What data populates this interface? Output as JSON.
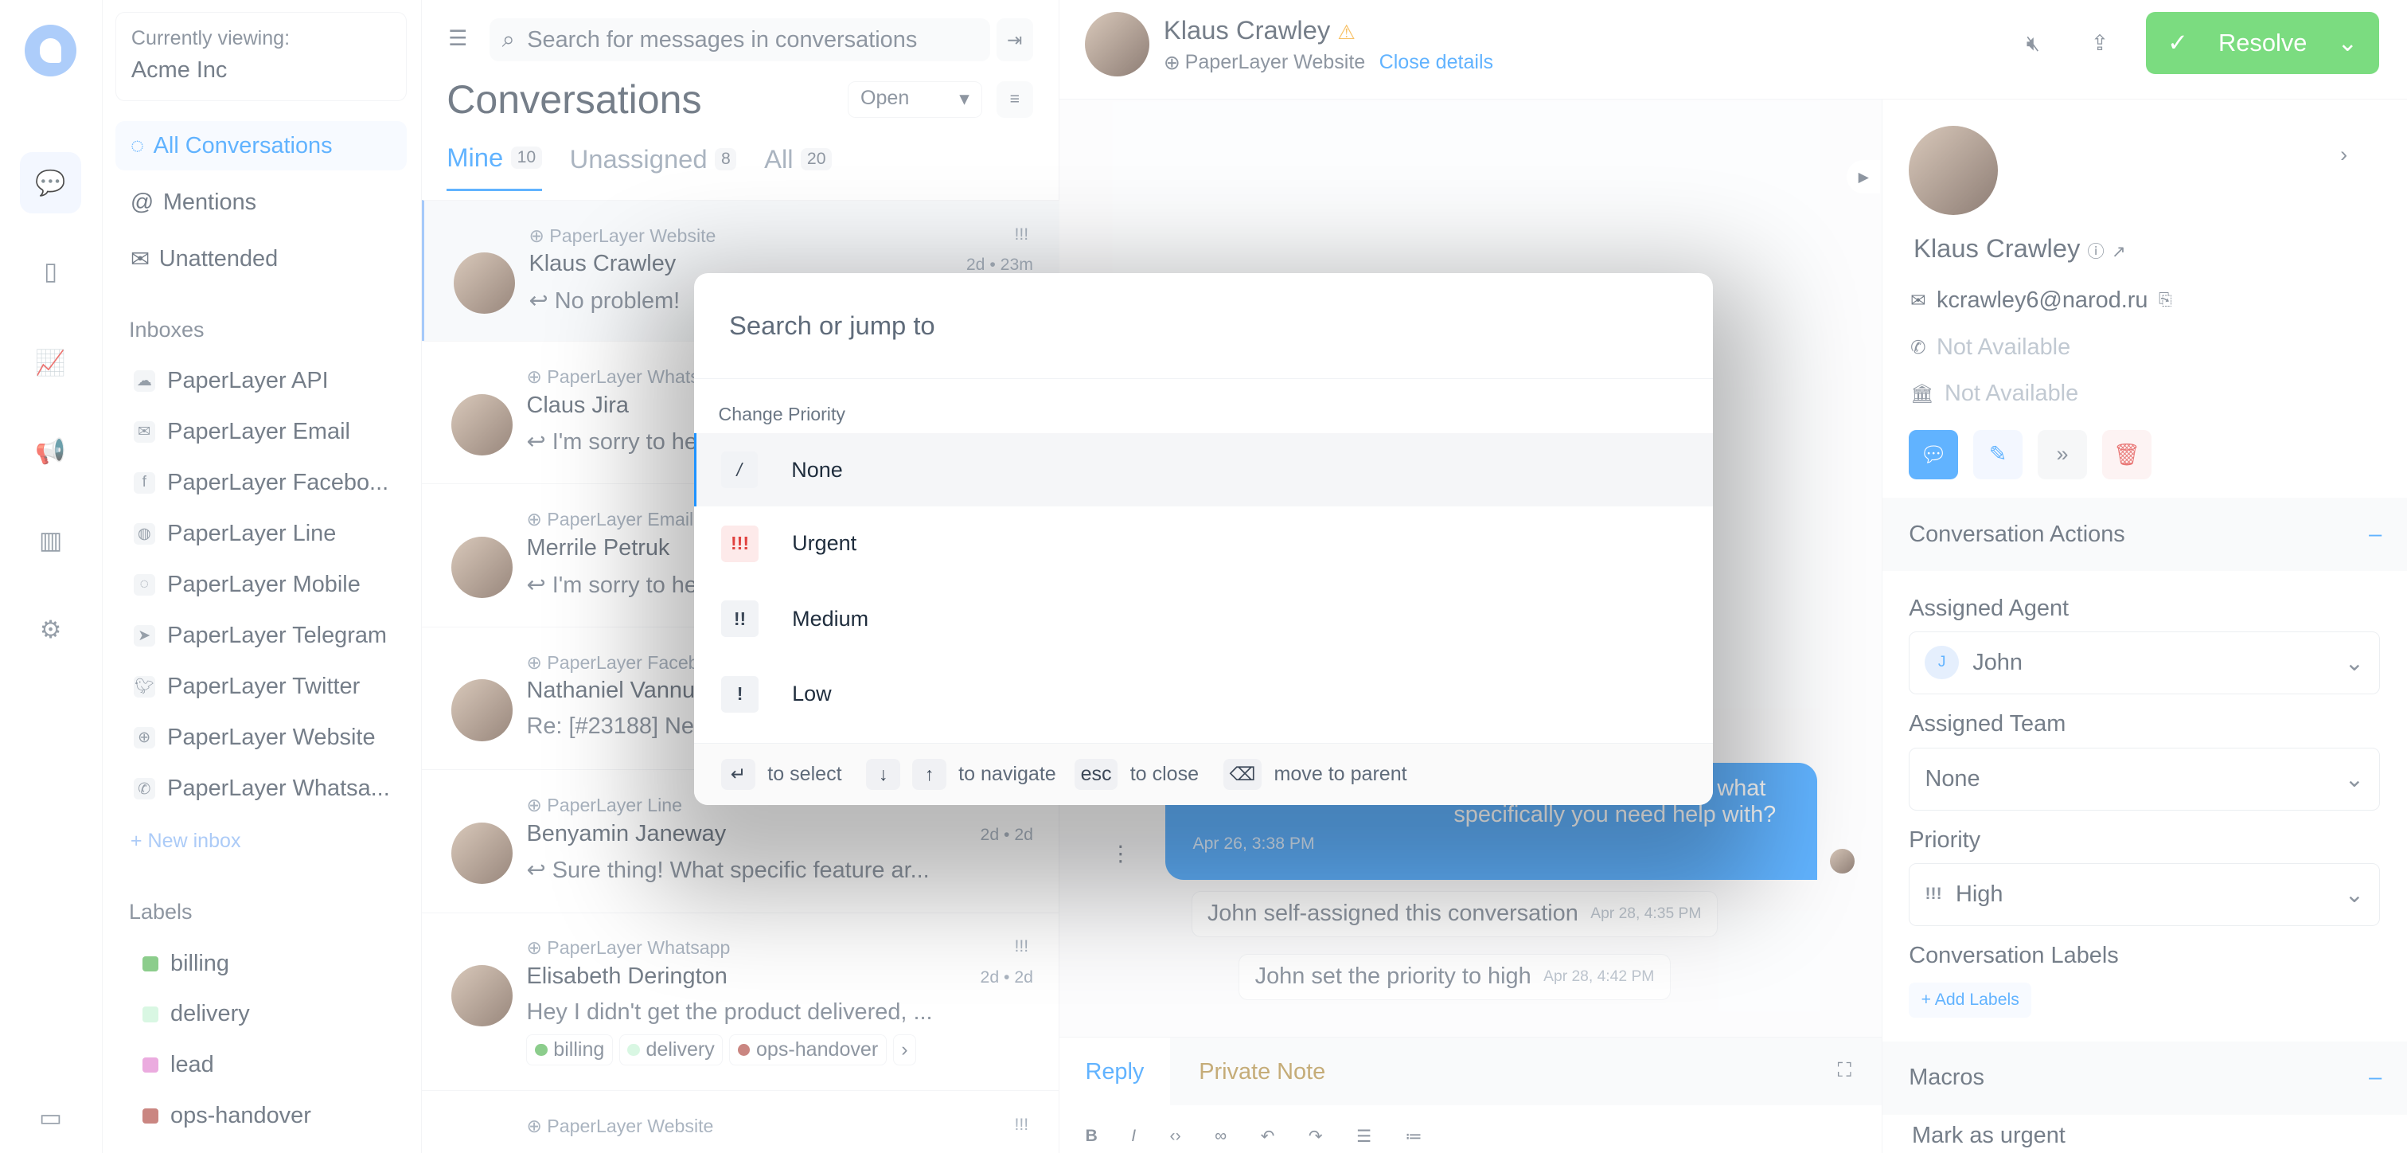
{
  "account": {
    "label": "Currently viewing:",
    "name": "Acme Inc"
  },
  "nav": [
    {
      "label": "All Conversations",
      "icon": "chat-icon"
    },
    {
      "label": "Mentions",
      "icon": "at-icon"
    },
    {
      "label": "Unattended",
      "icon": "mail-icon"
    }
  ],
  "inboxes_title": "Inboxes",
  "inboxes": [
    {
      "label": "PaperLayer API",
      "icon": "cloud-icon"
    },
    {
      "label": "PaperLayer Email",
      "icon": "mail-icon"
    },
    {
      "label": "PaperLayer Facebo...",
      "icon": "facebook-icon"
    },
    {
      "label": "PaperLayer Line",
      "icon": "line-icon"
    },
    {
      "label": "PaperLayer Mobile",
      "icon": "chat-icon"
    },
    {
      "label": "PaperLayer Telegram",
      "icon": "telegram-icon"
    },
    {
      "label": "PaperLayer Twitter",
      "icon": "twitter-icon"
    },
    {
      "label": "PaperLayer Website",
      "icon": "globe-icon"
    },
    {
      "label": "PaperLayer Whatsa...",
      "icon": "whatsapp-icon"
    }
  ],
  "new_inbox": "+ New inbox",
  "labels_title": "Labels",
  "labels": [
    {
      "label": "billing",
      "color": "#5cb85c"
    },
    {
      "label": "delivery",
      "color": "#c9f5d8"
    },
    {
      "label": "lead",
      "color": "#e388d2"
    },
    {
      "label": "ops-handover",
      "color": "#b4544d"
    }
  ],
  "list": {
    "search_placeholder": "Search for messages in conversations",
    "title": "Conversations",
    "status": "Open",
    "tabs": [
      {
        "label": "Mine",
        "count": "10"
      },
      {
        "label": "Unassigned",
        "count": "8"
      },
      {
        "label": "All",
        "count": "20"
      }
    ],
    "conversations": [
      {
        "channel": "PaperLayer Website",
        "name": "Klaus Crawley",
        "preview": "↩ No problem!",
        "time": "2d • 23m",
        "priority": "!!!"
      },
      {
        "channel": "PaperLayer Whatsapp",
        "name": "Claus Jira",
        "preview": "↩ I'm sorry to hear",
        "time": "",
        "priority": ""
      },
      {
        "channel": "PaperLayer Email",
        "name": "Merrile Petruk",
        "preview": "↩ I'm sorry to hear",
        "time": "",
        "priority": ""
      },
      {
        "channel": "PaperLayer Facebook",
        "name": "Nathaniel Vannuchi",
        "preview": "Re: [#23188] Ne",
        "time": "",
        "priority": ""
      },
      {
        "channel": "PaperLayer Line",
        "name": "Benyamin Janeway",
        "preview": "↩ Sure thing! What specific feature ar...",
        "time": "2d • 2d",
        "priority": ""
      },
      {
        "channel": "PaperLayer Whatsapp",
        "name": "Elisabeth Derington",
        "preview": "Hey I didn't get the product delivered, ...",
        "time": "2d • 2d",
        "priority": "!!!",
        "labels": [
          "billing",
          "delivery",
          "ops-handover"
        ]
      },
      {
        "channel": "PaperLayer Website",
        "name": "",
        "preview": "",
        "time": "",
        "priority": "!!!"
      }
    ]
  },
  "header": {
    "name": "Klaus Crawley",
    "inbox": "PaperLayer Website",
    "close_details": "Close details",
    "resolve": "Resolve",
    "resolve_color": "#44ce4b"
  },
  "messages": {
    "bubble": "model of your device and what specifically you need help with?",
    "bubble_time": "Apr 26, 3:38 PM",
    "activities": [
      {
        "text": "John self-assigned this conversation",
        "time": "Apr 28, 4:35 PM"
      },
      {
        "text": "John set the priority to high",
        "time": "Apr 28, 4:42 PM"
      }
    ]
  },
  "composer": {
    "reply": "Reply",
    "private_note": "Private Note"
  },
  "contact": {
    "name": "Klaus Crawley",
    "email": "kcrawley6@narod.ru",
    "phone": "Not Available",
    "company": "Not Available"
  },
  "actions": {
    "title": "Conversation Actions",
    "agent_label": "Assigned Agent",
    "agent": "John",
    "agent_initial": "J",
    "team_label": "Assigned Team",
    "team": "None",
    "priority_label": "Priority",
    "priority": "High",
    "priority_icon": "!!!",
    "labels_label": "Conversation Labels",
    "add_labels": "+ Add Labels"
  },
  "macros": {
    "title": "Macros",
    "item": "Mark as urgent"
  },
  "palette": {
    "placeholder": "Search or jump to",
    "group": "Change Priority",
    "options": [
      {
        "key": "/",
        "label": "None"
      },
      {
        "key": "!!!",
        "label": "Urgent"
      },
      {
        "key": "!!",
        "label": "Medium"
      },
      {
        "key": "!",
        "label": "Low"
      }
    ],
    "footer": {
      "select_key": "↵",
      "select": "to select",
      "down_key": "↓",
      "up_key": "↑",
      "navigate": "to navigate",
      "esc_key": "esc",
      "close": "to close",
      "back_key": "⌫",
      "parent": "move to parent"
    }
  }
}
